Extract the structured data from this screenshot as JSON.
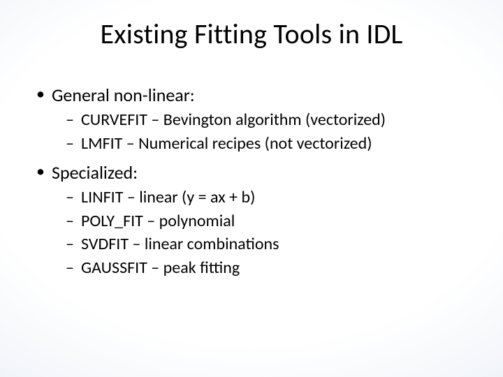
{
  "title": "Existing Fitting Tools in IDL",
  "sections": [
    {
      "heading": "General non-linear:",
      "items": [
        "CURVEFIT – Bevington algorithm (vectorized)",
        "LMFIT – Numerical recipes (not vectorized)"
      ]
    },
    {
      "heading": "Specialized:",
      "items": [
        "LINFIT – linear (y = ax + b)",
        "POLY_FIT – polynomial",
        "SVDFIT – linear combinations",
        "GAUSSFIT – peak fitting"
      ]
    }
  ]
}
